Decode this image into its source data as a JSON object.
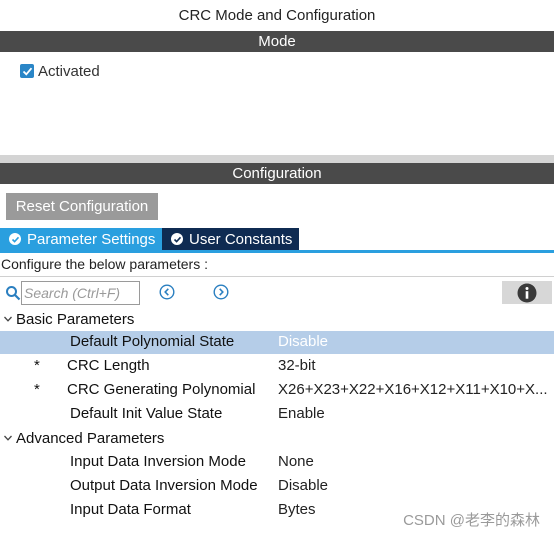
{
  "window": {
    "title": "CRC Mode and Configuration"
  },
  "mode": {
    "header": "Mode",
    "activated": {
      "label": "Activated",
      "checked": true
    }
  },
  "configuration": {
    "header": "Configuration",
    "reset_button": "Reset Configuration",
    "tabs": [
      {
        "label": "Parameter Settings",
        "active": true,
        "icon": "check-circle-icon"
      },
      {
        "label": "User Constants",
        "active": false,
        "icon": "check-circle-icon"
      }
    ],
    "instructions": "Configure the below parameters :",
    "search": {
      "placeholder": "Search (Ctrl+F)",
      "value": ""
    },
    "groups": [
      {
        "label": "Basic Parameters",
        "expanded": true,
        "params": [
          {
            "name": "Default Polynomial State",
            "value": "Disable",
            "required": false,
            "selected": true
          },
          {
            "name": "CRC Length",
            "value": "32-bit",
            "required": true,
            "selected": false
          },
          {
            "name": "CRC Generating Polynomial",
            "value": "X26+X23+X22+X16+X12+X11+X10+X...",
            "required": true,
            "selected": false
          },
          {
            "name": "Default Init Value State",
            "value": "Enable",
            "required": false,
            "selected": false
          }
        ]
      },
      {
        "label": "Advanced Parameters",
        "expanded": true,
        "params": [
          {
            "name": "Input Data Inversion Mode",
            "value": "None",
            "required": false,
            "selected": false
          },
          {
            "name": "Output Data Inversion Mode",
            "value": "Disable",
            "required": false,
            "selected": false
          },
          {
            "name": "Input Data Format",
            "value": "Bytes",
            "required": false,
            "selected": false
          }
        ]
      }
    ],
    "required_marker": "*"
  },
  "watermark": "CSDN @老李的森林",
  "colors": {
    "section_bar": "#4a4a4a",
    "tab_active": "#2a9fdf",
    "tab_inactive": "#0f2b52",
    "selected_row": "#b5cde8",
    "checkbox": "#2a86c7"
  }
}
